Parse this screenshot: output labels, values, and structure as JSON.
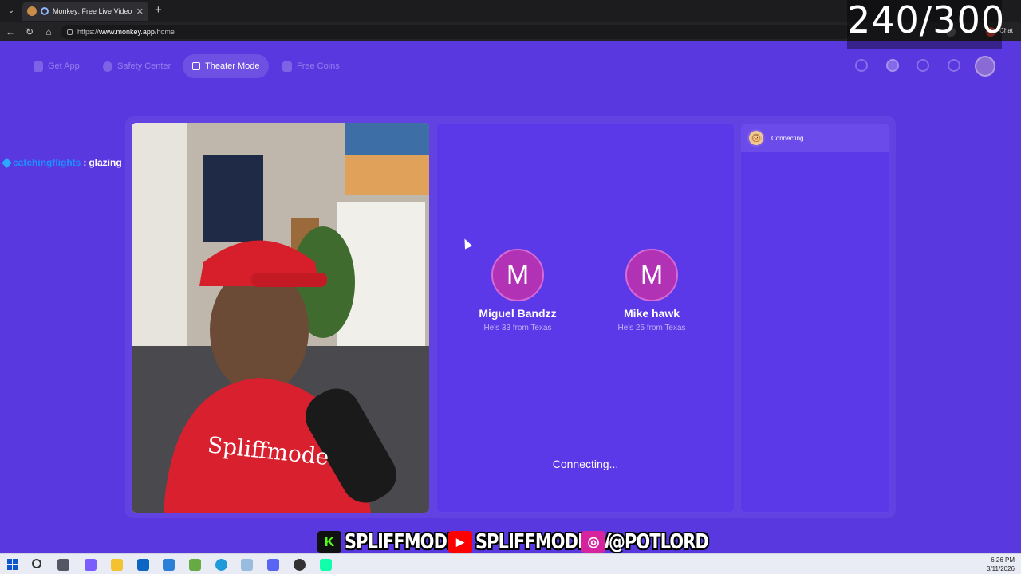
{
  "browser": {
    "tab_title": "Monkey: Free Live Video Chat",
    "tab_close": "✕",
    "new_tab": "+",
    "url_scheme": "https://",
    "url_host": "www.monkey.app",
    "url_path": "/home",
    "chat_label": "Chat"
  },
  "overlay": {
    "counter": "240/300"
  },
  "header": {
    "nav": [
      {
        "label": "Get App"
      },
      {
        "label": "Safety Center"
      },
      {
        "label": "Theater Mode"
      },
      {
        "label": "Free Coins"
      }
    ]
  },
  "chat": {
    "username": "catchingflights",
    "separator": ":",
    "message": "glazing"
  },
  "match": {
    "people": [
      {
        "initial": "M",
        "name": "Miguel Bandzz",
        "details": "He's 33 from Texas"
      },
      {
        "initial": "M",
        "name": "Mike hawk",
        "details": "He's 25 from Texas"
      }
    ],
    "status": "Connecting..."
  },
  "side_panel": {
    "status": "Connecting..."
  },
  "socials": [
    {
      "platform": "Kick",
      "logo": "K",
      "handle": "SPLIFFMODE",
      "color": "#53fc18"
    },
    {
      "platform": "YouTube",
      "logo": "▶",
      "handle": "SPLIFFMODETV",
      "color": "#ff0000"
    },
    {
      "platform": "Instagram",
      "logo": "◎",
      "handle": "@POTLORD",
      "color": "#d6249f"
    }
  ],
  "taskbar": {
    "time": "6:26 PM",
    "date": "3/11/2026"
  },
  "colors": {
    "background": "#5a38e0",
    "avatar": "#b132b5",
    "chat_user": "#1f8fff"
  }
}
